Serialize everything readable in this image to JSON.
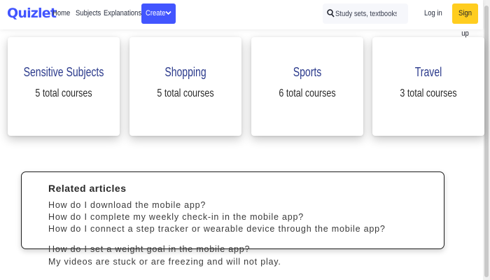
{
  "header": {
    "logo": "Quizlet",
    "nav": [
      "Home",
      "Subjects",
      "Explanations"
    ],
    "create_label": "Create",
    "search_placeholder": "Study sets, textbooks, ...",
    "login_label": "Log in",
    "signup_label": "Sign up",
    "accent_color": "#4255ff",
    "signup_color": "#ffcd1f"
  },
  "categories": [
    {
      "title": "Sensitive Subjects",
      "subtitle": "5 total courses"
    },
    {
      "title": "Shopping",
      "subtitle": "5 total courses"
    },
    {
      "title": "Sports",
      "subtitle": "6 total courses"
    },
    {
      "title": "Travel",
      "subtitle": "3 total courses"
    }
  ],
  "related": {
    "title": "Related articles",
    "articles": [
      "How do I download the mobile app?",
      "How do I complete my weekly check-in in the mobile app?",
      "How do I connect a step tracker or wearable device through the mobile app?",
      "How do I set a weight goal in the mobile app?",
      "My videos are stuck or are freezing and will not play."
    ]
  }
}
